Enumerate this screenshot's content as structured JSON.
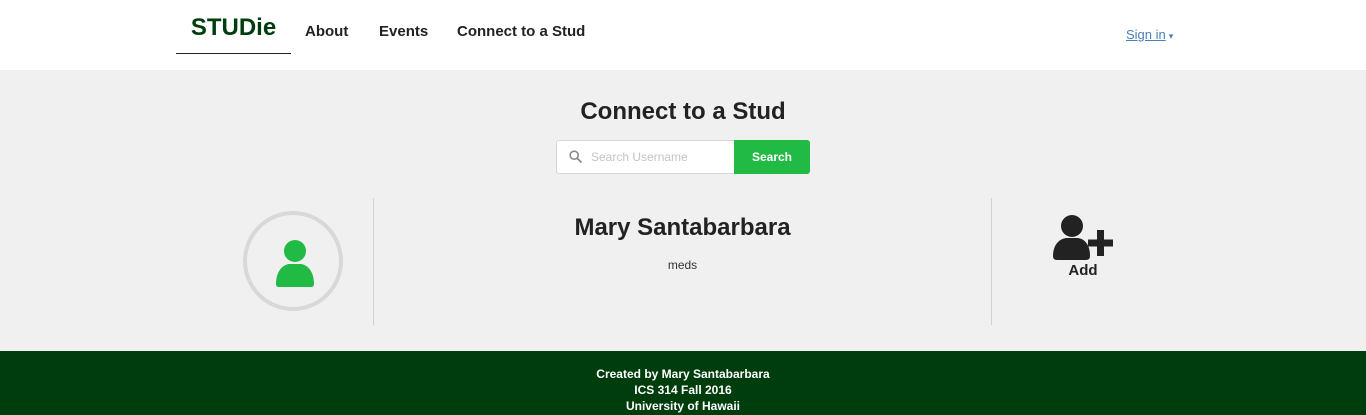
{
  "nav": {
    "brand": "STUDie",
    "links": [
      "About",
      "Events",
      "Connect to a Stud"
    ],
    "signin": "Sign in",
    "signin_caret": "▾"
  },
  "page": {
    "title": "Connect to a Stud"
  },
  "search": {
    "placeholder": "Search Username",
    "value": "",
    "button_label": "Search"
  },
  "profile": {
    "name": "Mary Santabarbara",
    "tag": "meds",
    "add_label": "Add",
    "avatar_icon": "user-icon",
    "add_icon": "user-plus-icon"
  },
  "footer": {
    "lines": [
      "Created by Mary Santabarbara",
      "ICS 314 Fall 2016",
      "University of Hawaii"
    ]
  },
  "colors": {
    "brand_green": "#003d0d",
    "accent_green": "#21ba45",
    "link_blue": "#4a7fb5",
    "background": "#f1f0f0"
  }
}
